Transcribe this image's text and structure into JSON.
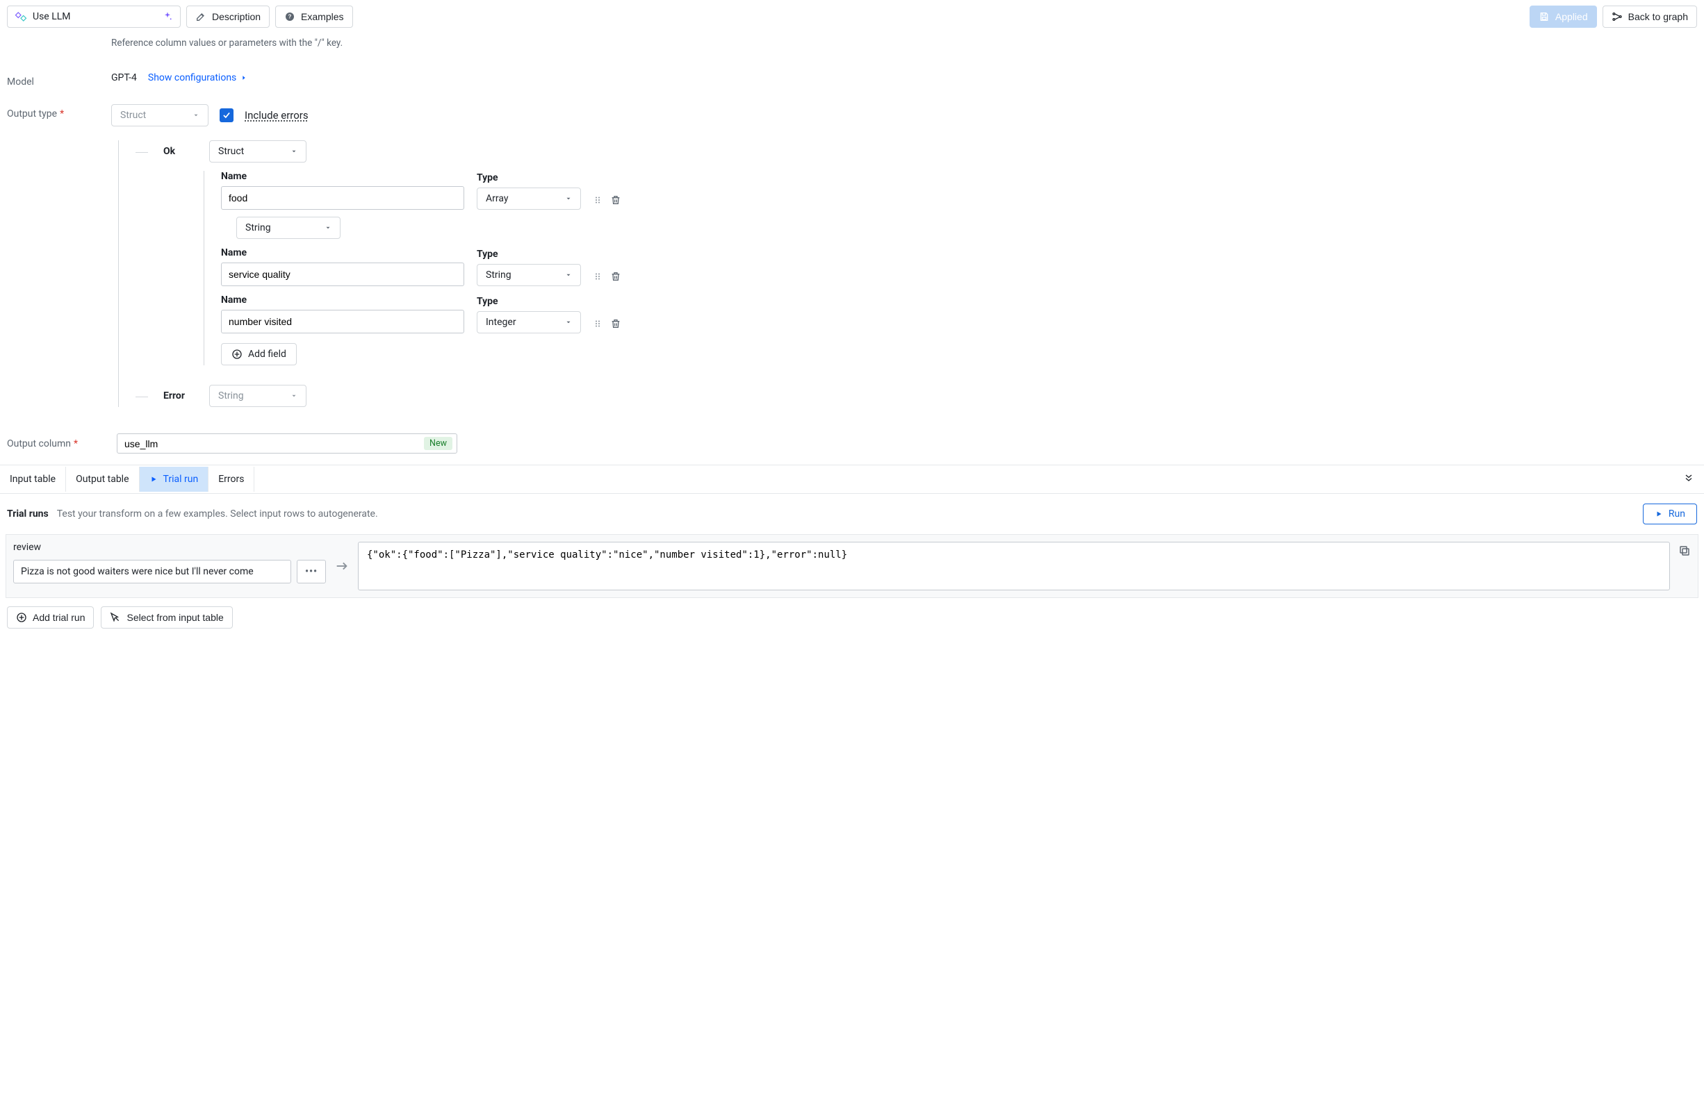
{
  "topbar": {
    "node_title": "Use LLM",
    "description_btn": "Description",
    "examples_btn": "Examples",
    "applied_btn": "Applied",
    "back_btn": "Back to graph"
  },
  "form": {
    "hint": "Reference column values or parameters with the \"/\" key.",
    "model_label": "Model",
    "model_value": "GPT-4",
    "show_config_link": "Show configurations",
    "output_type_label": "Output type",
    "output_type_value": "Struct",
    "include_errors_label": "Include errors",
    "ok_label": "Ok",
    "ok_type": "Struct",
    "name_header": "Name",
    "type_header": "Type",
    "fields": [
      {
        "name": "food",
        "type": "Array",
        "subtype": "String"
      },
      {
        "name": "service quality",
        "type": "String"
      },
      {
        "name": "number visited",
        "type": "Integer"
      }
    ],
    "add_field": "Add field",
    "error_label": "Error",
    "error_type": "String",
    "output_column_label": "Output column",
    "output_column_value": "use_llm",
    "output_column_badge": "New"
  },
  "tabs": {
    "input_table": "Input table",
    "output_table": "Output table",
    "trial_run": "Trial run",
    "errors": "Errors"
  },
  "trial": {
    "title": "Trial runs",
    "desc": "Test your transform on a few examples. Select input rows to autogenerate.",
    "run_btn": "Run",
    "input_label": "review",
    "input_value": "Pizza is not good waiters were nice but I'll never come",
    "output_value": "{\"ok\":{\"food\":[\"Pizza\"],\"service quality\":\"nice\",\"number visited\":1},\"error\":null}",
    "add_trial_run": "Add trial run",
    "select_from_input": "Select from input table"
  }
}
